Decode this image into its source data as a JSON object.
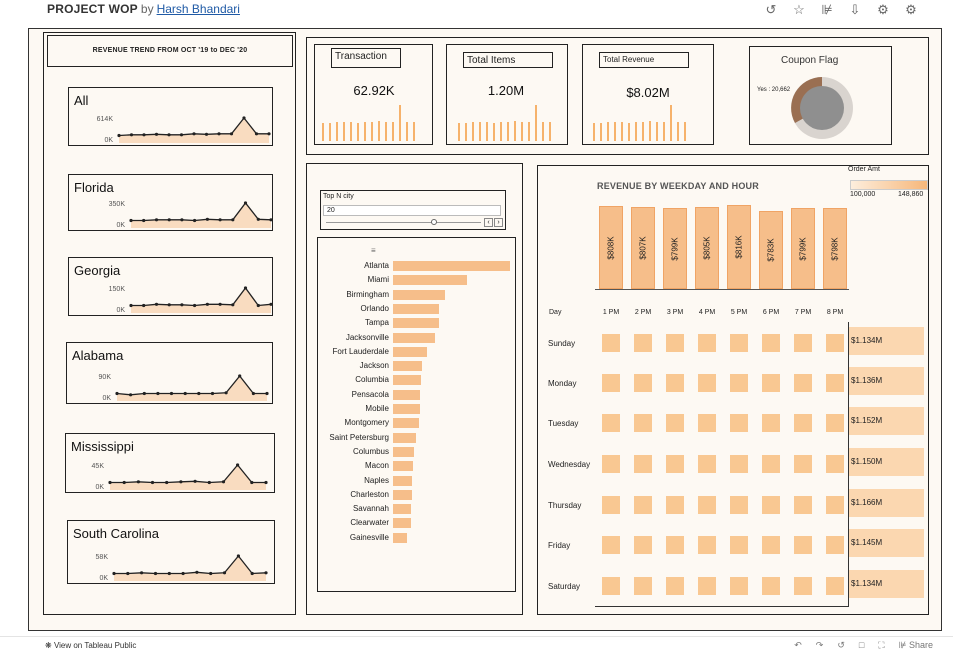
{
  "header": {
    "title": "PROJECT WOP",
    "by": "by",
    "author": "Harsh Bhandari",
    "icons": [
      "revert-icon",
      "star-icon",
      "share-node-icon",
      "download-icon",
      "alert-icon",
      "settings-icon"
    ]
  },
  "trend": {
    "title": "REVENUE TREND FROM OCT '19 to DEC '20",
    "states": [
      {
        "name": "All",
        "top_tick": "614K",
        "zero_tick": "0K",
        "values": [
          0.3,
          0.33,
          0.33,
          0.35,
          0.33,
          0.33,
          0.37,
          0.35,
          0.37,
          0.37,
          1.0,
          0.37,
          0.37
        ]
      },
      {
        "name": "Florida",
        "top_tick": "350K",
        "zero_tick": "0K",
        "values": [
          0.3,
          0.3,
          0.33,
          0.33,
          0.33,
          0.3,
          0.35,
          0.33,
          0.33,
          1.0,
          0.35,
          0.33
        ]
      },
      {
        "name": "Georgia",
        "top_tick": "150K",
        "zero_tick": "0K",
        "values": [
          0.3,
          0.3,
          0.35,
          0.33,
          0.33,
          0.3,
          0.35,
          0.35,
          0.33,
          1.0,
          0.3,
          0.35
        ]
      },
      {
        "name": "Alabama",
        "top_tick": "90K",
        "zero_tick": "0K",
        "values": [
          0.3,
          0.25,
          0.3,
          0.3,
          0.3,
          0.3,
          0.3,
          0.3,
          0.33,
          1.0,
          0.3,
          0.3
        ]
      },
      {
        "name": "Mississippi",
        "top_tick": "45K",
        "zero_tick": "0K",
        "values": [
          0.3,
          0.3,
          0.33,
          0.3,
          0.3,
          0.33,
          0.35,
          0.3,
          0.33,
          1.0,
          0.3,
          0.3
        ]
      },
      {
        "name": "South Carolina",
        "top_tick": "58K",
        "zero_tick": "0K",
        "values": [
          0.3,
          0.3,
          0.33,
          0.3,
          0.3,
          0.3,
          0.35,
          0.3,
          0.33,
          1.0,
          0.3,
          0.33
        ]
      }
    ]
  },
  "kpis": [
    {
      "label": "Transaction",
      "value": "62.92K",
      "bars": [
        0.8,
        0.8,
        0.85,
        0.85,
        0.85,
        0.8,
        0.85,
        0.85,
        0.9,
        0.85,
        0.85,
        1.6,
        0.85,
        0.85
      ]
    },
    {
      "label": "Total Items",
      "value": "1.20M",
      "bars": [
        0.8,
        0.8,
        0.85,
        0.85,
        0.85,
        0.8,
        0.85,
        0.85,
        0.9,
        0.85,
        0.85,
        1.6,
        0.85,
        0.85
      ]
    },
    {
      "label": "Total Revenue",
      "value": "$8.02M",
      "bars": [
        0.8,
        0.8,
        0.85,
        0.85,
        0.85,
        0.8,
        0.85,
        0.85,
        0.9,
        0.85,
        0.85,
        1.6,
        0.85,
        0.85
      ]
    }
  ],
  "coupon": {
    "title": "Coupon Flag",
    "label": "Yes : 20,662"
  },
  "topn": {
    "label": "Top N city",
    "value": "20",
    "sort_icon": "sort-icon"
  },
  "cities": [
    {
      "name": "Atlanta",
      "value": 1.0
    },
    {
      "name": "Miami",
      "value": 0.63
    },
    {
      "name": "Birmingham",
      "value": 0.44
    },
    {
      "name": "Orlando",
      "value": 0.39
    },
    {
      "name": "Tampa",
      "value": 0.39
    },
    {
      "name": "Jacksonville",
      "value": 0.36
    },
    {
      "name": "Fort Lauderdale",
      "value": 0.29
    },
    {
      "name": "Jackson",
      "value": 0.25
    },
    {
      "name": "Columbia",
      "value": 0.24
    },
    {
      "name": "Pensacola",
      "value": 0.23
    },
    {
      "name": "Mobile",
      "value": 0.23
    },
    {
      "name": "Montgomery",
      "value": 0.22
    },
    {
      "name": "Saint Petersburg",
      "value": 0.2
    },
    {
      "name": "Columbus",
      "value": 0.18
    },
    {
      "name": "Macon",
      "value": 0.17
    },
    {
      "name": "Naples",
      "value": 0.16
    },
    {
      "name": "Charleston",
      "value": 0.16
    },
    {
      "name": "Savannah",
      "value": 0.15
    },
    {
      "name": "Clearwater",
      "value": 0.15
    },
    {
      "name": "Gainesville",
      "value": 0.12
    }
  ],
  "heatmap": {
    "title": "REVENUE BY WEEKDAY AND HOUR",
    "legend_title": "Order Amt",
    "legend_min": "100,000",
    "legend_max": "148,860",
    "hour_totals": [
      "$808K",
      "$807K",
      "$799K",
      "$805K",
      "$816K",
      "$783K",
      "$799K",
      "$798K"
    ],
    "day_header": "Day",
    "hours": [
      "1 PM",
      "2 PM",
      "3 PM",
      "4 PM",
      "5 PM",
      "6 PM",
      "7 PM",
      "8 PM"
    ],
    "days": [
      "Sunday",
      "Monday",
      "Tuesday",
      "Wednesday",
      "Thursday",
      "Friday",
      "Saturday"
    ],
    "day_totals": [
      "$1.134M",
      "$1.136M",
      "$1.152M",
      "$1.150M",
      "$1.166M",
      "$1.145M",
      "$1.134M"
    ]
  },
  "footer": {
    "view_label": "View on Tableau Public",
    "share_label": "Share",
    "icons": [
      "undo-icon",
      "redo-icon",
      "revert-icon",
      "comment-icon",
      "fullscreen-icon",
      "share-icon"
    ]
  }
}
